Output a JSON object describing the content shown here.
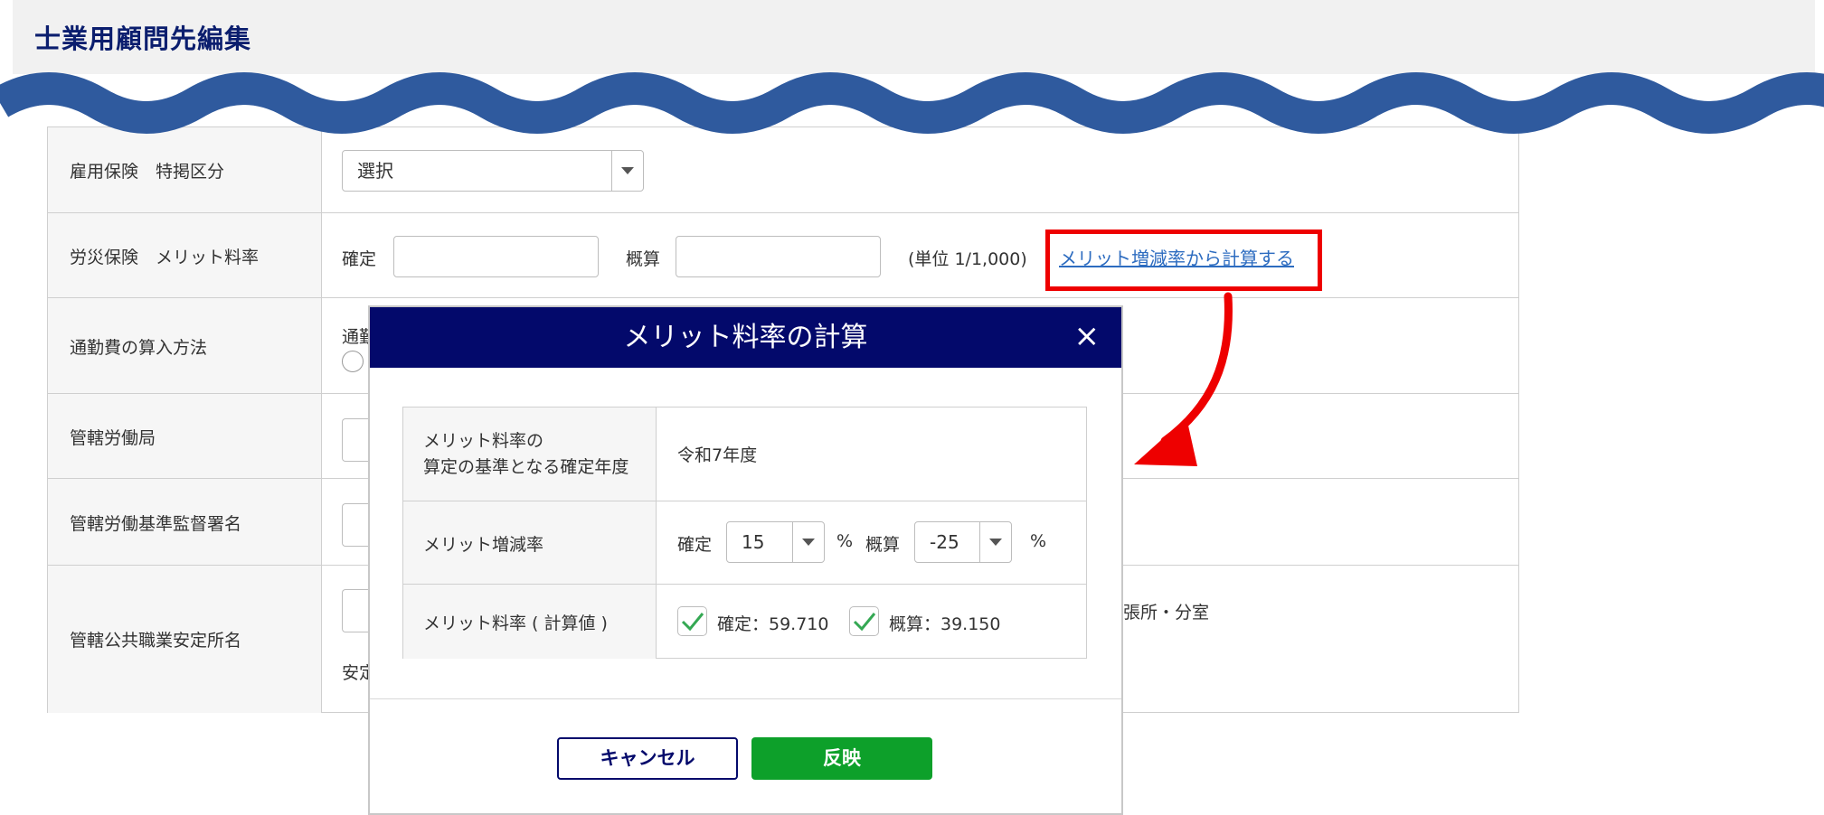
{
  "page": {
    "title": "士業用顧問先編集"
  },
  "form": {
    "rows": [
      {
        "label": "雇用保険　特掲区分",
        "select_value": "選択"
      },
      {
        "label": "労災保険　メリット料率",
        "fixed_label": "確定",
        "estimate_label": "概算",
        "unit_text": "(単位 1/1,000)",
        "link_text": "メリット増減率から計算する"
      },
      {
        "label": "通勤費の算入方法",
        "partial_text": "通勤"
      },
      {
        "label": "管轄労働局"
      },
      {
        "label": "管轄労働基準監督署名"
      },
      {
        "label": "管轄公共職業安定所名",
        "partial_right_text": "張所・分室",
        "partial_bottom_text": "安定"
      }
    ]
  },
  "modal": {
    "title": "メリット料率の計算",
    "close_icon": "×",
    "rows": [
      {
        "label_line1": "メリット料率の",
        "label_line2": "算定の基準となる確定年度",
        "value": "令和7年度"
      },
      {
        "label": "メリット増減率",
        "fixed_label": "確定",
        "fixed_value": "15",
        "percent1": "%",
        "estimate_label": "概算",
        "estimate_value": "-25",
        "percent2": "%"
      },
      {
        "label": "メリット料率 ( 計算値 )",
        "fixed_result": "確定：59.710",
        "estimate_result": "概算：39.150"
      }
    ],
    "cancel_label": "キャンセル",
    "apply_label": "反映"
  },
  "colors": {
    "title": "#0b1e6e",
    "modal_header": "#03096b",
    "apply_button": "#0da02a",
    "highlight": "#ee0000",
    "link": "#2d6cc0",
    "wave": "#2f5a9e",
    "check": "#34a853"
  }
}
